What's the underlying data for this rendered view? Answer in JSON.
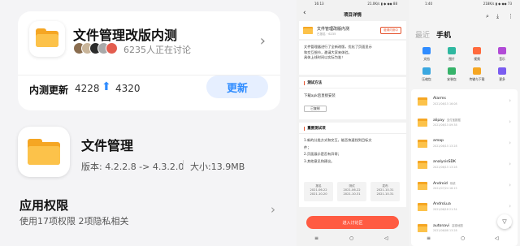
{
  "left": {
    "beta": {
      "title": "文件管理改版内测",
      "participants": "6235人正在讨论",
      "update_label": "内测更新",
      "from_version": "4228",
      "to_version": "4320",
      "update_button": "更新"
    },
    "app": {
      "name": "文件管理",
      "version": "版本: 4.2.2.8 -> 4.3.2.0",
      "size": "大小:13.9MB"
    },
    "permissions": {
      "title": "应用权限",
      "desc": "使用17项权限 2项隐私相关"
    },
    "colors": {
      "accent": "#2f8cff",
      "folder": "#f5a623",
      "folder_front": "#fcc24a"
    }
  },
  "middle": {
    "status_time": "16:13",
    "status_right": "21.0K/s ▮ ◆ ◆◆ 88",
    "title": "项目详情",
    "app_name": "文件管理改版内测",
    "app_sub": "已报名 · 6235",
    "tag": "邀请内测中",
    "desc": [
      "文件管理器进行了全新改版，优化了页面显示",
      "和交互细节，邀请大家来体验。",
      "具体上线时间以实际为准！"
    ],
    "method_title": "测试方法",
    "method_text": "下载apk后直接安装",
    "copy_button": "已复制",
    "content_title": "重要测试项",
    "content_items": [
      "1.新的分类方式和交互，能否快速找到目标文",
      "件；",
      "2.页面展示是否有异常；",
      "3.其他意见和建议。"
    ],
    "dates": [
      {
        "label": "报名",
        "a": "2021.06.22",
        "b": "2021.10.20"
      },
      {
        "label": "测试",
        "a": "2021.06.22",
        "b": "2021.10.31"
      },
      {
        "label": "发布",
        "a": "2021.10.31",
        "b": "2021.10.31"
      }
    ],
    "cta": "进入讨论区",
    "cta_color": "#ff5b42"
  },
  "right": {
    "status_time": "1:40",
    "status_right": "218K/s ▮ ◆ ◆◆ 73",
    "tab_recent": "最近",
    "tab_phone": "手机",
    "categories": [
      {
        "label": "文档",
        "color": "#2f8cff"
      },
      {
        "label": "图片",
        "color": "#2fb8a0"
      },
      {
        "label": "视频",
        "color": "#ff6a3d"
      },
      {
        "label": "音乐",
        "color": "#b14bd6"
      },
      {
        "label": "压缩包",
        "color": "#3aa7e0"
      },
      {
        "label": "安装包",
        "color": "#36b36a"
      },
      {
        "label": "传输与下载",
        "color": "#f5a623"
      },
      {
        "label": "更多",
        "color": "#7a5cf0"
      }
    ],
    "files": [
      {
        "name": "Alarms",
        "tag": "",
        "date": "2021/06/15 16:08"
      },
      {
        "name": "alipay",
        "tag": "支付宝数据",
        "date": "2021/06/15 09:38"
      },
      {
        "name": "amap",
        "tag": "",
        "date": "2021/06/15 13:28"
      },
      {
        "name": "analysisSDK",
        "tag": "",
        "date": "2021/06/15 13:28"
      },
      {
        "name": "Android",
        "tag": "系统",
        "date": "2021/07/24 16:15"
      },
      {
        "name": "AndroLua",
        "tag": "",
        "date": "2021/06/18 21:34"
      },
      {
        "name": "autonavi",
        "tag": "高德地图",
        "date": "2021/06/08 13:28"
      }
    ]
  }
}
